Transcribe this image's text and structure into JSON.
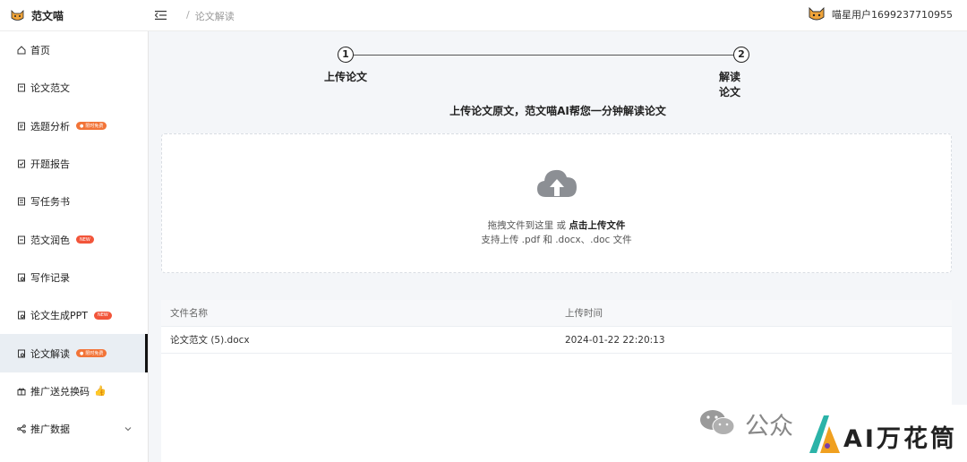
{
  "app": {
    "name": "范文喵"
  },
  "breadcrumb": {
    "separator": "/",
    "current": "论文解读"
  },
  "user": {
    "name": "喵星用户1699237710955"
  },
  "sidebar": {
    "items": [
      {
        "label": "首页",
        "icon": "home-icon"
      },
      {
        "label": "论文范文",
        "icon": "document-icon"
      },
      {
        "label": "选题分析",
        "icon": "topic-icon",
        "tag": "限时免费"
      },
      {
        "label": "开题报告",
        "icon": "report-icon"
      },
      {
        "label": "写任务书",
        "icon": "task-icon"
      },
      {
        "label": "范文润色",
        "icon": "polish-icon",
        "tag": "NEW"
      },
      {
        "label": "写作记录",
        "icon": "history-icon"
      },
      {
        "label": "论文生成PPT",
        "icon": "ppt-icon",
        "tag": "NEW"
      },
      {
        "label": "论文解读",
        "icon": "interpret-icon",
        "tag": "限时免费",
        "active": true
      },
      {
        "label": "推广送兑换码",
        "icon": "gift-icon"
      },
      {
        "label": "推广数据",
        "icon": "share-icon"
      }
    ]
  },
  "steps": [
    {
      "number": "1",
      "label": "上传论文"
    },
    {
      "number": "2",
      "label": "解读论文"
    }
  ],
  "subtitle": "上传论文原文，范文喵AI帮您一分钟解读论文",
  "upload": {
    "prefix": "拖拽文件到这里 或 ",
    "link": "点击上传文件",
    "hint": "支持上传 .pdf 和 .docx、.doc 文件"
  },
  "table": {
    "headers": [
      "文件名称",
      "上传时间"
    ],
    "rows": [
      {
        "name": "论文范文 (5).docx",
        "time": "2024-01-22 22:20:13"
      }
    ]
  },
  "watermark": {
    "prefix": "公众",
    "brand": "AI万花筒"
  },
  "colors": {
    "accent": "#f27438",
    "new": "#f2553a",
    "active_bg": "#e9eef3"
  }
}
